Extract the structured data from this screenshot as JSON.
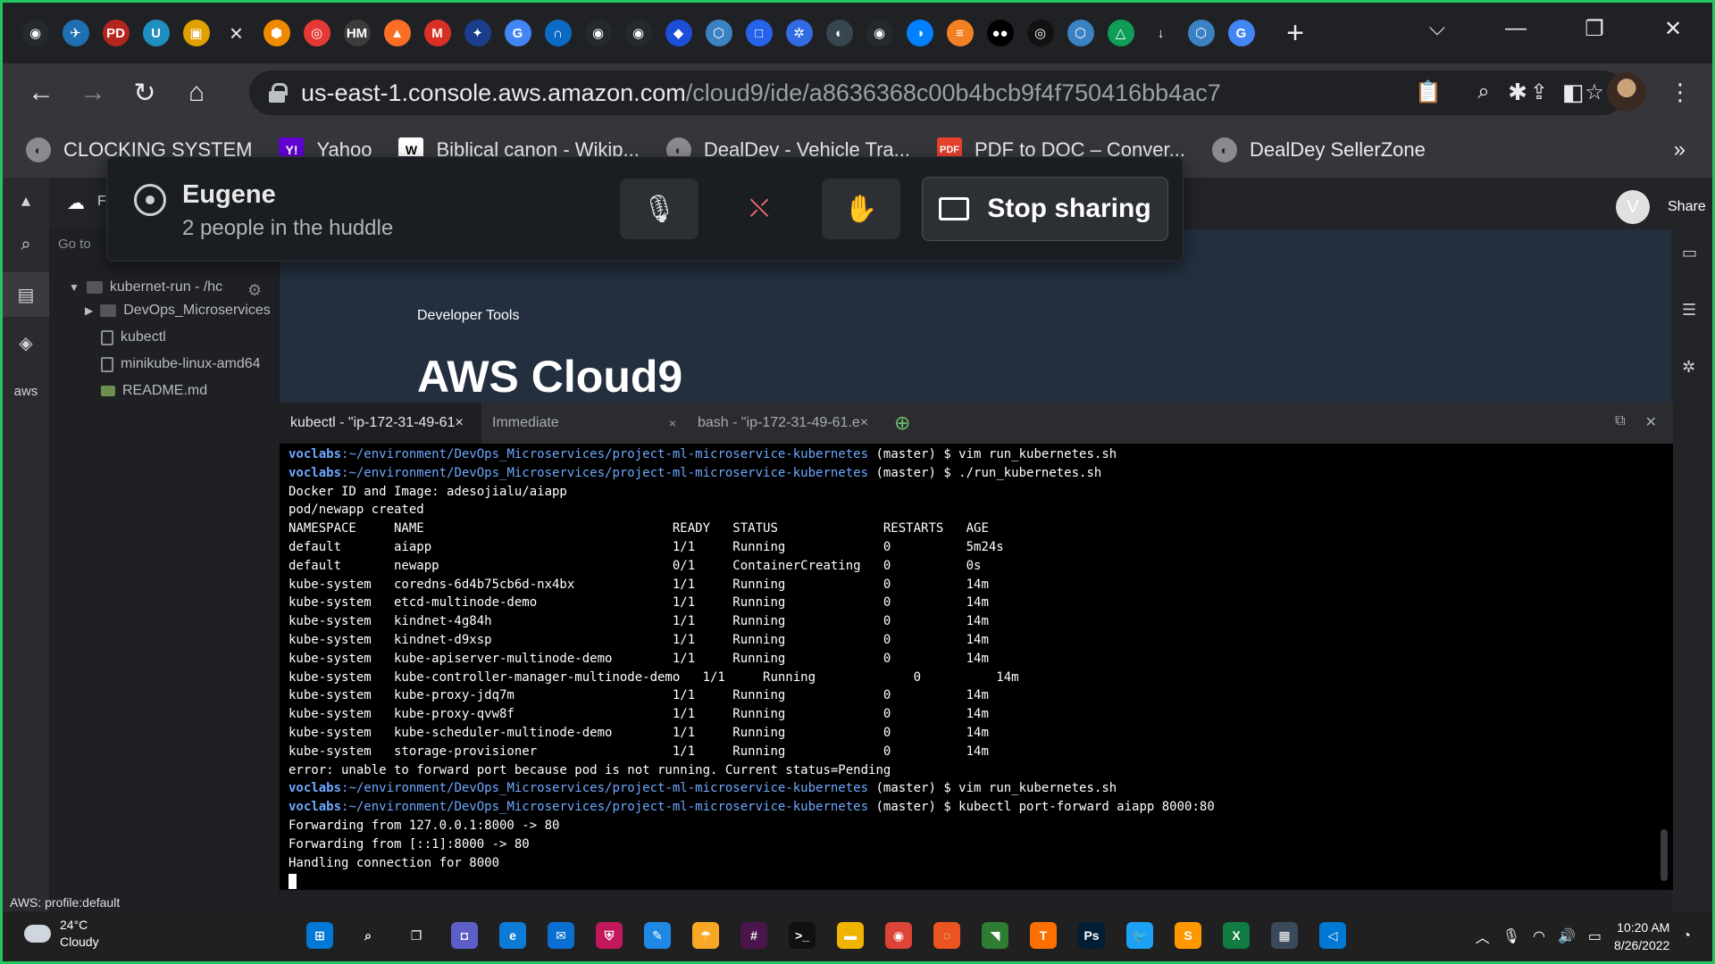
{
  "browser": {
    "tab_icons": [
      {
        "name": "github-tab-icon",
        "glyph": "◉",
        "color": "#24292f"
      },
      {
        "name": "plane-tab-icon",
        "glyph": "✈",
        "color": "#1f6fb2"
      },
      {
        "name": "pdf-tab-icon",
        "glyph": "PD",
        "color": "#b3261e"
      },
      {
        "name": "udemy-tab-icon",
        "glyph": "U",
        "color": "#1f8fbf"
      },
      {
        "name": "box-tab-icon",
        "glyph": "▣",
        "color": "#e0a100"
      },
      {
        "name": "close-tab-icon",
        "glyph": "×",
        "color": "transparent"
      },
      {
        "name": "aws-tab-icon",
        "glyph": "⬢",
        "color": "#f08a00"
      },
      {
        "name": "record-tab-icon",
        "glyph": "◎",
        "color": "#e53935"
      },
      {
        "name": "harvey-mudd-tab-icon",
        "glyph": "HM",
        "color": "#3c3c3c"
      },
      {
        "name": "gitlab-tab-icon",
        "glyph": "▲",
        "color": "#fc6d26"
      },
      {
        "name": "gmail-tab-icon",
        "glyph": "M",
        "color": "#d93025"
      },
      {
        "name": "flag-tab-icon",
        "glyph": "✦",
        "color": "#1a3e8c"
      },
      {
        "name": "google-tab-icon",
        "glyph": "G",
        "color": "#4285f4"
      },
      {
        "name": "headphones-tab-icon",
        "glyph": "∩",
        "color": "#0b6bc4"
      },
      {
        "name": "github-tab-icon-2",
        "glyph": "◉",
        "color": "#24292f"
      },
      {
        "name": "github-tab-icon-3",
        "glyph": "◉",
        "color": "#24292f"
      },
      {
        "name": "jira-tab-icon",
        "glyph": "◆",
        "color": "#1d4ed8"
      },
      {
        "name": "shield-tab-icon",
        "glyph": "⬡",
        "color": "#3b82c4"
      },
      {
        "name": "browser-tab-icon",
        "glyph": "□",
        "color": "#2563eb"
      },
      {
        "name": "kubernetes-tab-icon",
        "glyph": "✲",
        "color": "#326ce5"
      },
      {
        "name": "docker-tab-icon",
        "glyph": "◐",
        "color": "#37474f"
      },
      {
        "name": "github-tab-icon-4",
        "glyph": "◉",
        "color": "#24292f"
      },
      {
        "name": "digitalocean-tab-icon",
        "glyph": "◑",
        "color": "#0080ff"
      },
      {
        "name": "stackoverflow-tab-icon",
        "glyph": "≡",
        "color": "#f48024"
      },
      {
        "name": "medium-tab-icon",
        "glyph": "●●",
        "color": "#000000"
      },
      {
        "name": "target-tab-icon",
        "glyph": "◎",
        "color": "#111111"
      },
      {
        "name": "shield-tab-icon-2",
        "glyph": "⬡",
        "color": "#3b82c4"
      },
      {
        "name": "google-drive-tab-icon",
        "glyph": "△",
        "color": "#0f9d58"
      },
      {
        "name": "download-tab-icon",
        "glyph": "↓",
        "color": "#202124"
      },
      {
        "name": "shield-tab-icon-3",
        "glyph": "⬡",
        "color": "#3b82c4"
      },
      {
        "name": "google-tab-icon-2",
        "glyph": "G",
        "color": "#4285f4"
      }
    ],
    "new_tab": "+",
    "window_controls": {
      "dropdown": "⌵",
      "minimize": "—",
      "restore": "❐",
      "close": "✕"
    },
    "nav": {
      "back": "←",
      "forward": "→",
      "reload": "↻",
      "home": "⌂"
    },
    "url_host": "us-east-1.console.aws.amazon.com",
    "url_path": "/cloud9/ide/a8636368c00b4bcb9f4f750416bb4ac7",
    "omnibox_icons": {
      "clipboard": "📋",
      "zoom": "⌕",
      "share": "⇪",
      "star": "☆"
    },
    "toolbar_icons": {
      "extensions": "✱",
      "sidepanel": "◧",
      "menu": "⋮"
    },
    "bookmarks": [
      {
        "label": "CLOCKING SYSTEM",
        "icon": "◐",
        "cls": "g"
      },
      {
        "label": "Yahoo",
        "icon": "Y!",
        "cls": "y"
      },
      {
        "label": "Biblical canon - Wikip...",
        "icon": "W",
        "cls": "w"
      },
      {
        "label": "DealDev - Vehicle Tra...",
        "icon": "◐",
        "cls": "g"
      },
      {
        "label": "PDF to DOC – Conver...",
        "icon": "PDF",
        "cls": "p"
      },
      {
        "label": "DealDey SellerZone",
        "icon": "◐",
        "cls": "g"
      }
    ],
    "bookmarks_more": "»"
  },
  "huddle": {
    "name": "Eugene",
    "subtitle": "2 people in the huddle",
    "mic_icon": "🎙",
    "video_icon": "⛌",
    "reaction_icon": "✋",
    "stop_label": "Stop sharing"
  },
  "ide": {
    "share_label": "Share",
    "avatar_letter": "V",
    "left_icons": {
      "collapse": "▴",
      "cloud": "☁",
      "search": "⌕",
      "files": "▤",
      "git": "◈",
      "aws": "aws"
    },
    "top_partial": "F",
    "goto_label": "Go to",
    "tree": {
      "root": "kubernet-run - /hc",
      "items": [
        {
          "label": "DevOps_Microservices",
          "type": "folder"
        },
        {
          "label": "kubectl",
          "type": "file"
        },
        {
          "label": "minikube-linux-amd64",
          "type": "file"
        },
        {
          "label": "README.md",
          "type": "md"
        }
      ]
    },
    "status": "AWS: profile:default",
    "welcome": {
      "devtools": "Developer Tools",
      "title": "AWS Cloud9"
    },
    "terminal_tabs": [
      {
        "label": "kubectl - \"ip-172-31-49-61×",
        "active": true
      },
      {
        "label": "Immediate",
        "active": false
      },
      {
        "label": "bash - \"ip-172-31-49-61.e×",
        "active": false
      }
    ],
    "add_tab": "⊕",
    "tab_close": "×",
    "term_tools": {
      "restore": "⧉",
      "close": "✕"
    },
    "terminal": {
      "prompt_user": "voclabs",
      "prompt_path": ":~/environment/DevOps_Microservices/project-ml-microservice-kubernetes",
      "lines": [
        {
          "type": "prompt",
          "cmd": " (master) $ vim run_kubernetes.sh"
        },
        {
          "type": "prompt",
          "cmd": " (master) $ ./run_kubernetes.sh"
        },
        {
          "type": "out",
          "text": "Docker ID and Image: adesojialu/aiapp"
        },
        {
          "type": "out",
          "text": "pod/newapp created"
        },
        {
          "type": "out",
          "text": "NAMESPACE     NAME                                 READY   STATUS              RESTARTS   AGE"
        },
        {
          "type": "out",
          "text": "default       aiapp                                1/1     Running             0          5m24s"
        },
        {
          "type": "out",
          "text": "default       newapp                               0/1     ContainerCreating   0          0s"
        },
        {
          "type": "out",
          "text": "kube-system   coredns-6d4b75cb6d-nx4bx             1/1     Running             0          14m"
        },
        {
          "type": "out",
          "text": "kube-system   etcd-multinode-demo                  1/1     Running             0          14m"
        },
        {
          "type": "out",
          "text": "kube-system   kindnet-4g84h                        1/1     Running             0          14m"
        },
        {
          "type": "out",
          "text": "kube-system   kindnet-d9xsp                        1/1     Running             0          14m"
        },
        {
          "type": "out",
          "text": "kube-system   kube-apiserver-multinode-demo        1/1     Running             0          14m"
        },
        {
          "type": "out",
          "text": "kube-system   kube-controller-manager-multinode-demo   1/1     Running             0          14m"
        },
        {
          "type": "out",
          "text": "kube-system   kube-proxy-jdq7m                     1/1     Running             0          14m"
        },
        {
          "type": "out",
          "text": "kube-system   kube-proxy-qvw8f                     1/1     Running             0          14m"
        },
        {
          "type": "out",
          "text": "kube-system   kube-scheduler-multinode-demo        1/1     Running             0          14m"
        },
        {
          "type": "out",
          "text": "kube-system   storage-provisioner                  1/1     Running             0          14m"
        },
        {
          "type": "out",
          "text": "error: unable to forward port because pod is not running. Current status=Pending"
        },
        {
          "type": "prompt",
          "cmd": " (master) $ vim run_kubernetes.sh"
        },
        {
          "type": "prompt",
          "cmd": " (master) $ kubectl port-forward aiapp 8000:80"
        },
        {
          "type": "out",
          "text": "Forwarding from 127.0.0.1:8000 -> 80"
        },
        {
          "type": "out",
          "text": "Forwarding from [::1]:8000 -> 80"
        },
        {
          "type": "out",
          "text": "Handling connection for 8000"
        }
      ]
    }
  },
  "taskbar": {
    "temp": "24°C",
    "weather": "Cloudy",
    "apps": [
      {
        "name": "start-button",
        "glyph": "⊞",
        "color": "#0078d4"
      },
      {
        "name": "search-button",
        "glyph": "⌕",
        "color": "transparent"
      },
      {
        "name": "task-view-button",
        "glyph": "❐",
        "color": "transparent"
      },
      {
        "name": "chat-app",
        "glyph": "◘",
        "color": "#5b5fc7"
      },
      {
        "name": "edge-app",
        "glyph": "e",
        "color": "#0c7bd6"
      },
      {
        "name": "mail-app",
        "glyph": "✉",
        "color": "#0a6fd1"
      },
      {
        "name": "security-app",
        "glyph": "⛨",
        "color": "#c2185b"
      },
      {
        "name": "whiteboard-app",
        "glyph": "✎",
        "color": "#1e88e5"
      },
      {
        "name": "weather-app",
        "glyph": "☂",
        "color": "#f9a825"
      },
      {
        "name": "slack-app",
        "glyph": "#",
        "color": "#4a154b"
      },
      {
        "name": "terminal-app",
        "glyph": ">_",
        "color": "#111111"
      },
      {
        "name": "explorer-app",
        "glyph": "▬",
        "color": "#f0b400"
      },
      {
        "name": "chrome-app",
        "glyph": "◉",
        "color": "#db4437"
      },
      {
        "name": "ubuntu-app",
        "glyph": "◌",
        "color": "#e95420"
      },
      {
        "name": "nvidia-app",
        "glyph": "◥",
        "color": "#2e7d32"
      },
      {
        "name": "tensorflow-app",
        "glyph": "T",
        "color": "#ff6f00"
      },
      {
        "name": "photoshop-app",
        "glyph": "Ps",
        "color": "#001e36"
      },
      {
        "name": "twitter-app",
        "glyph": "🐦",
        "color": "#1da1f2"
      },
      {
        "name": "sublime-app",
        "glyph": "S",
        "color": "#ff9800"
      },
      {
        "name": "excel-app",
        "glyph": "X",
        "color": "#107c41"
      },
      {
        "name": "calculator-app",
        "glyph": "▦",
        "color": "#3a4a5a"
      },
      {
        "name": "vscode-app",
        "glyph": "◁",
        "color": "#0078d4"
      }
    ],
    "tray": {
      "chevron": "︿",
      "mic": "🎙",
      "wifi": "◠",
      "volume": "🔊",
      "battery": "▭",
      "notif": "◔"
    },
    "time": "10:20 AM",
    "date": "8/26/2022"
  },
  "colors": {
    "border": "#22c55e",
    "aws_dark": "#232f3e",
    "prompt": "#6ea8ff"
  }
}
